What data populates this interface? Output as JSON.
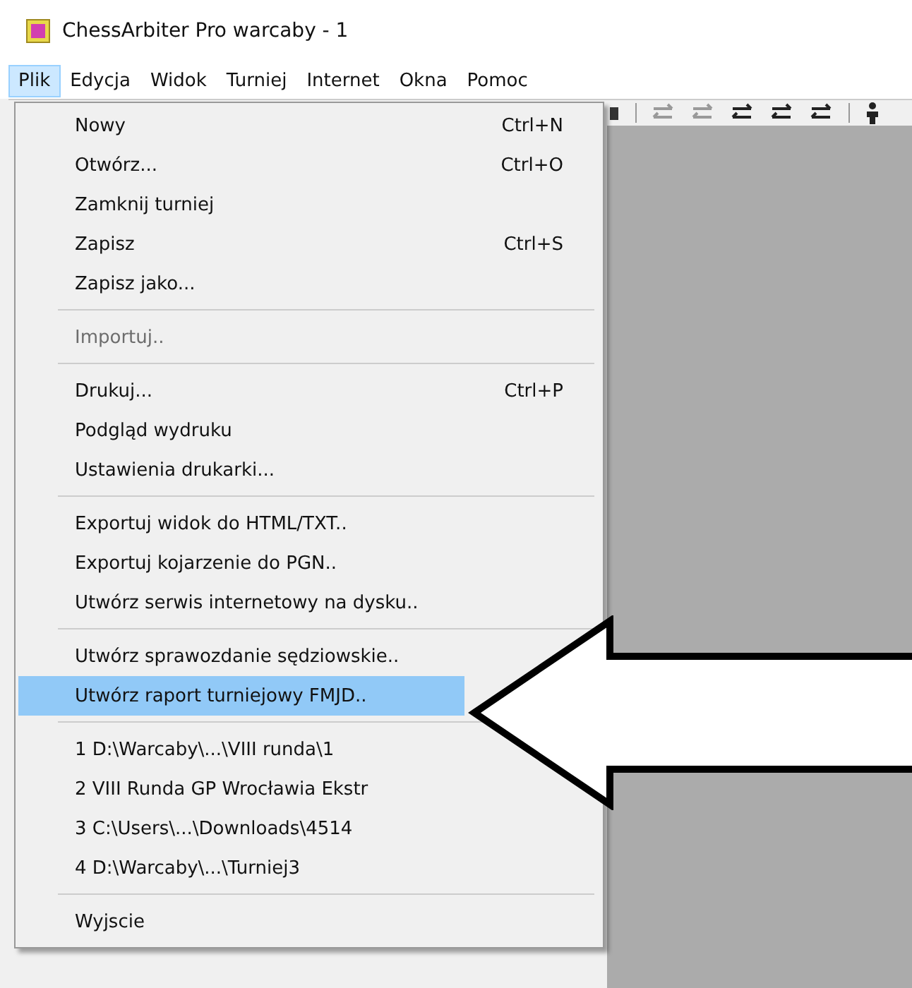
{
  "window": {
    "title": "ChessArbiter Pro warcaby - 1"
  },
  "menubar": [
    {
      "label": "Plik",
      "selected": true
    },
    {
      "label": "Edycja",
      "selected": false
    },
    {
      "label": "Widok",
      "selected": false
    },
    {
      "label": "Turniej",
      "selected": false
    },
    {
      "label": "Internet",
      "selected": false
    },
    {
      "label": "Okna",
      "selected": false
    },
    {
      "label": "Pomoc",
      "selected": false
    }
  ],
  "file_menu": {
    "items": [
      {
        "kind": "item",
        "label": "Nowy",
        "shortcut": "Ctrl+N",
        "disabled": false,
        "selected": false
      },
      {
        "kind": "item",
        "label": "Otwórz...",
        "shortcut": "Ctrl+O",
        "disabled": false,
        "selected": false
      },
      {
        "kind": "item",
        "label": "Zamknij turniej",
        "disabled": false,
        "selected": false
      },
      {
        "kind": "item",
        "label": "Zapisz",
        "shortcut": "Ctrl+S",
        "disabled": false,
        "selected": false
      },
      {
        "kind": "item",
        "label": "Zapisz jako...",
        "disabled": false,
        "selected": false
      },
      {
        "kind": "separator"
      },
      {
        "kind": "item",
        "label": "Importuj..",
        "disabled": true,
        "selected": false
      },
      {
        "kind": "separator"
      },
      {
        "kind": "item",
        "label": "Drukuj...",
        "shortcut": "Ctrl+P",
        "disabled": false,
        "selected": false
      },
      {
        "kind": "item",
        "label": "Podgląd wydruku",
        "disabled": false,
        "selected": false
      },
      {
        "kind": "item",
        "label": "Ustawienia drukarki...",
        "disabled": false,
        "selected": false
      },
      {
        "kind": "separator"
      },
      {
        "kind": "item",
        "label": "Exportuj widok do HTML/TXT..",
        "disabled": false,
        "selected": false
      },
      {
        "kind": "item",
        "label": "Exportuj kojarzenie do PGN..",
        "disabled": false,
        "selected": false
      },
      {
        "kind": "item",
        "label": "Utwórz serwis internetowy na dysku..",
        "disabled": false,
        "selected": false
      },
      {
        "kind": "separator"
      },
      {
        "kind": "item",
        "label": "Utwórz sprawozdanie sędziowskie..",
        "disabled": false,
        "selected": false
      },
      {
        "kind": "item",
        "label": "Utwórz raport turniejowy FMJD..",
        "disabled": false,
        "selected": true
      },
      {
        "kind": "separator"
      },
      {
        "kind": "item",
        "label": "1 D:\\Warcaby\\...\\VIII runda\\1",
        "disabled": false,
        "selected": false
      },
      {
        "kind": "item",
        "label": "2 VIII Runda GP Wrocławia Ekstr",
        "disabled": false,
        "selected": false
      },
      {
        "kind": "item",
        "label": "3 C:\\Users\\...\\Downloads\\4514",
        "disabled": false,
        "selected": false
      },
      {
        "kind": "item",
        "label": "4 D:\\Warcaby\\...\\Turniej3",
        "disabled": false,
        "selected": false
      },
      {
        "kind": "separator"
      },
      {
        "kind": "item",
        "label": "Wyjscie",
        "disabled": false,
        "selected": false
      }
    ]
  }
}
